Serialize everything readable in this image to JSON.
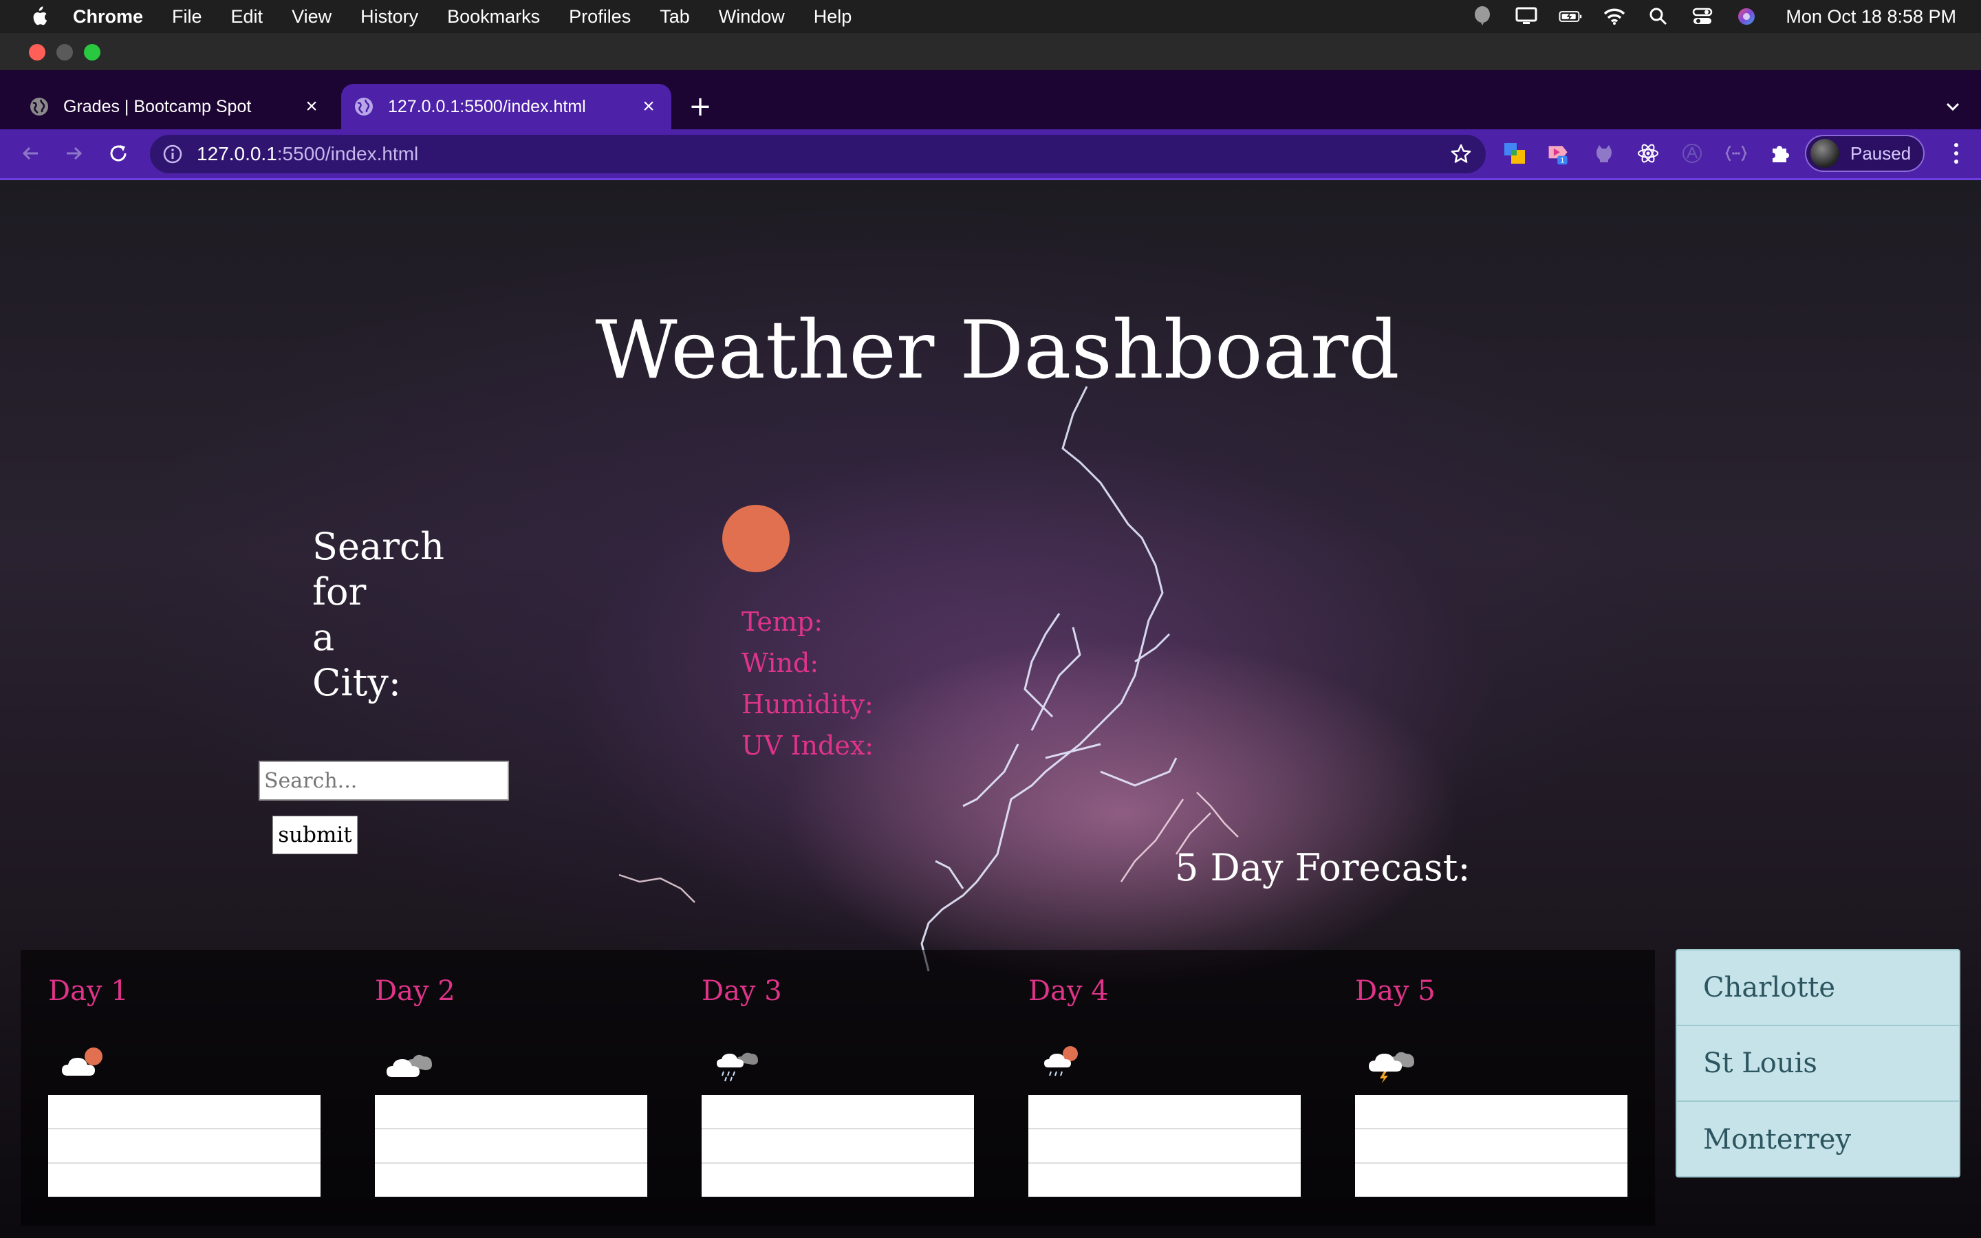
{
  "menubar": {
    "app_name": "Chrome",
    "items": [
      "File",
      "Edit",
      "View",
      "History",
      "Bookmarks",
      "Profiles",
      "Tab",
      "Window",
      "Help"
    ],
    "clock": "Mon Oct 18  8:58 PM"
  },
  "tabs": [
    {
      "title": "Grades | Bootcamp Spot",
      "icon": "globe-icon"
    },
    {
      "title": "127.0.0.1:5500/index.html",
      "icon": "globe-icon"
    }
  ],
  "omnibox": {
    "host": "127.0.0.1",
    "path": ":5500/index.html"
  },
  "profile": {
    "status": "Paused"
  },
  "extensions": {
    "badge_count": "1"
  },
  "page": {
    "title": "Weather Dashboard",
    "search_heading_lines": [
      "Search",
      "for",
      "a",
      "City:"
    ],
    "search_placeholder": "Search...",
    "submit_label": "submit",
    "current": {
      "temp_label": "Temp:",
      "wind_label": "Wind:",
      "humidity_label": "Humidity:",
      "uv_label": "UV Index:"
    },
    "forecast_heading": "5 Day Forecast:",
    "days": [
      {
        "title": "Day 1",
        "icon": "cloud-sun-icon"
      },
      {
        "title": "Day 2",
        "icon": "cloudy-icon"
      },
      {
        "title": "Day 3",
        "icon": "rain-cloud-icon"
      },
      {
        "title": "Day 4",
        "icon": "cloud-sun-rain-icon"
      },
      {
        "title": "Day 5",
        "icon": "storm-cloud-icon"
      }
    ],
    "history": [
      "Charlotte",
      "St Louis",
      "Monterrey"
    ]
  },
  "colors": {
    "accent_pink": "#e0348a",
    "toolbar_purple": "#4d21a8",
    "history_bg": "#c5e3e8",
    "sun_orange": "#e07050"
  }
}
